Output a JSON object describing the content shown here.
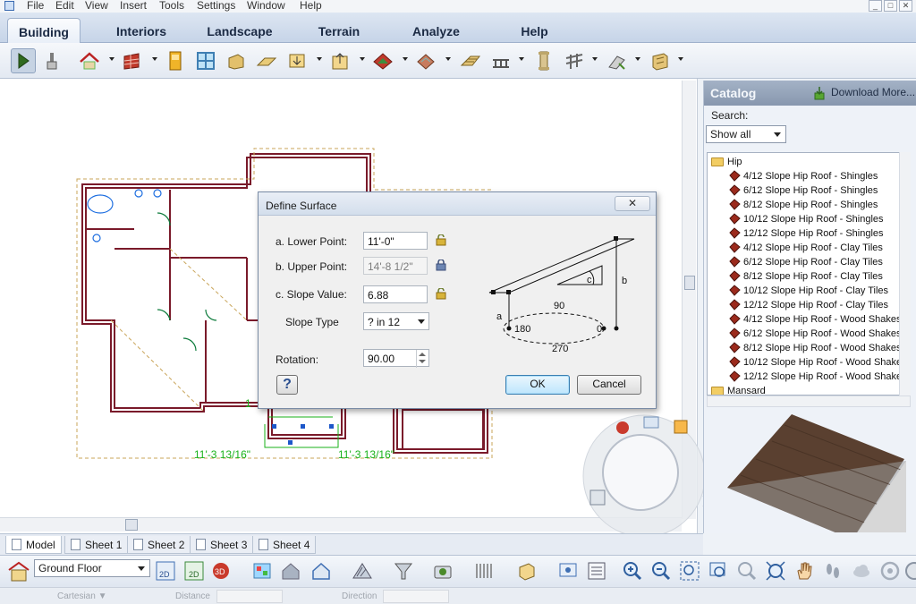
{
  "menu": [
    "File",
    "Edit",
    "View",
    "Insert",
    "Tools",
    "Settings",
    "Window",
    "Help"
  ],
  "window_controls": [
    "_",
    "□",
    "✕"
  ],
  "tabs": [
    "Building",
    "Interiors",
    "Landscape",
    "Terrain",
    "Analyze",
    "Help"
  ],
  "active_tab": "Building",
  "plan": {
    "dimensions": [
      "11'-3 13/16\"",
      "11'-3 13/16\""
    ],
    "marker": "1"
  },
  "dialog": {
    "title": "Define Surface",
    "close": "✕",
    "lower_point_label": "a. Lower Point:",
    "lower_point_value": "11'-0\"",
    "upper_point_label": "b. Upper Point:",
    "upper_point_value": "14'-8 1/2\"",
    "slope_value_label": "c. Slope Value:",
    "slope_value": "6.88",
    "slope_type_label": "Slope Type",
    "slope_type_value": "? in 12",
    "rotation_label": "Rotation:",
    "rotation_value": "90.00",
    "help": "?",
    "ok": "OK",
    "cancel": "Cancel",
    "diagram": {
      "a": "a",
      "b": "b",
      "c": "c",
      "angles": [
        "90",
        "180",
        "0",
        "270"
      ]
    }
  },
  "catalog": {
    "title": "Catalog",
    "download": "Download More...",
    "search_label": "Search:",
    "filter": "Show all",
    "tree": {
      "folder": "Hip",
      "items": [
        "4/12 Slope Hip Roof - Shingles",
        "6/12 Slope Hip Roof - Shingles",
        "8/12 Slope Hip Roof - Shingles",
        "10/12 Slope Hip Roof - Shingles",
        "12/12 Slope Hip Roof - Shingles",
        "4/12 Slope Hip Roof - Clay Tiles",
        "6/12 Slope Hip Roof - Clay Tiles",
        "8/12 Slope Hip Roof - Clay Tiles",
        "10/12 Slope Hip Roof - Clay Tiles",
        "12/12 Slope Hip Roof - Clay Tiles",
        "4/12 Slope Hip Roof - Wood Shakes",
        "6/12 Slope Hip Roof - Wood Shakes",
        "8/12 Slope Hip Roof - Wood Shakes",
        "10/12 Slope Hip Roof - Wood Shake",
        "12/12 Slope Hip Roof - Wood Shake"
      ],
      "next_folder": "Mansard"
    }
  },
  "sheets": [
    "Model",
    "Sheet 1",
    "Sheet 2",
    "Sheet 3",
    "Sheet 4"
  ],
  "active_sheet": "Model",
  "floor": "Ground Floor",
  "status": {
    "cartesian": "Cartesian ▼",
    "distance": "Distance",
    "direction": "Direction"
  },
  "colors": {
    "accent": "#2b5fb0",
    "dimension_green": "#19b219",
    "wall_red": "#7a1a2a",
    "catalog_header": "#8d9cb3",
    "roof_brown": "#5a4030"
  }
}
